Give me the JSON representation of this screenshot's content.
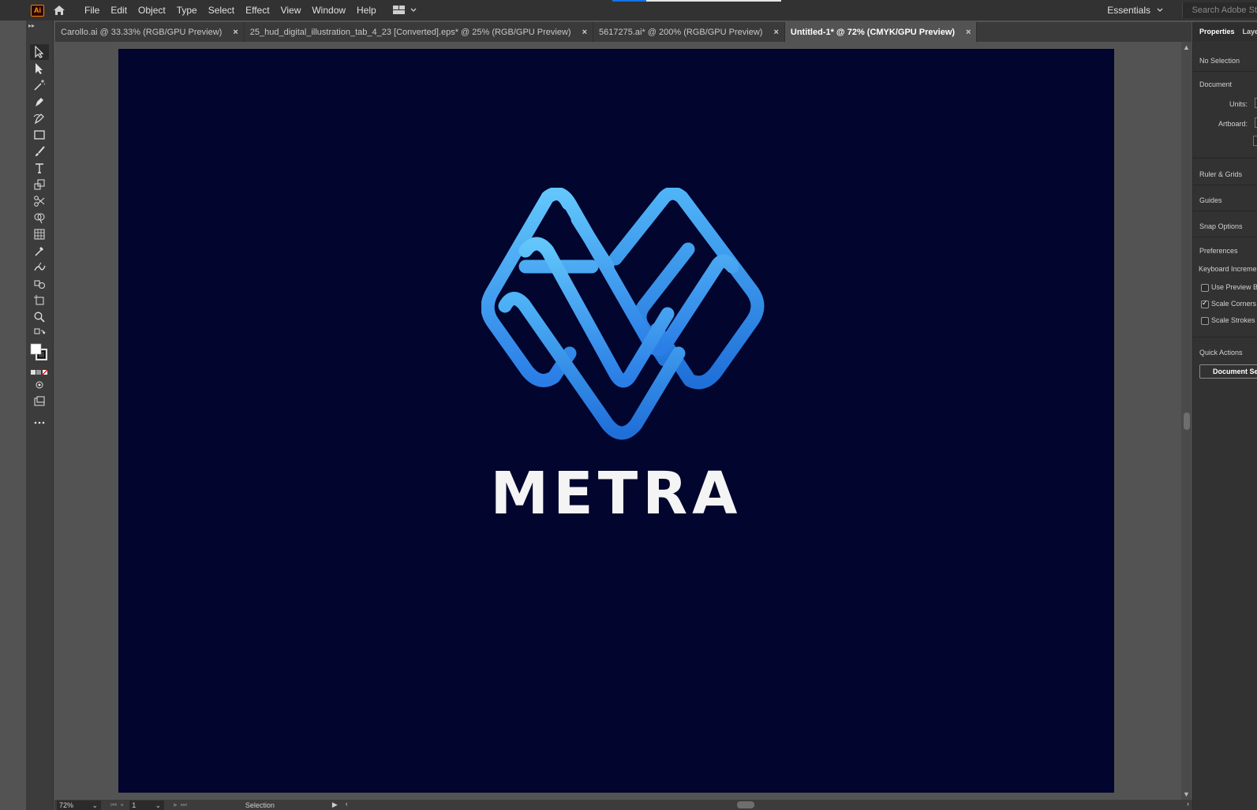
{
  "app": {
    "logo": "Ai"
  },
  "menu": [
    "File",
    "Edit",
    "Object",
    "Type",
    "Select",
    "Effect",
    "View",
    "Window",
    "Help"
  ],
  "workspace": {
    "label": "Essentials"
  },
  "search": {
    "placeholder": "Search Adobe St"
  },
  "tabs": [
    {
      "label": "Carollo.ai @ 33.33% (RGB/GPU Preview)",
      "close": "×",
      "active": false
    },
    {
      "label": "25_hud_digital_illustration_tab_4_23 [Converted].eps* @ 25% (RGB/GPU Preview)",
      "close": "×",
      "active": false
    },
    {
      "label": "5617275.ai* @ 200% (RGB/GPU Preview)",
      "close": "×",
      "active": false
    },
    {
      "label": "Untitled-1* @ 72% (CMYK/GPU Preview)",
      "close": "×",
      "active": true
    }
  ],
  "artwork": {
    "wordmark": "METRA",
    "background": "#02052e",
    "gradient_top": "#62c6fb",
    "gradient_bottom": "#2a7ee6"
  },
  "status": {
    "zoom": "72%",
    "page": "1",
    "mode": "Selection"
  },
  "panel": {
    "tabs": [
      "Properties",
      "Layers"
    ],
    "no_selection": "No Selection",
    "document": "Document",
    "units_label": "Units:",
    "artboard_label": "Artboard:",
    "ruler_grids": "Ruler & Grids",
    "guides": "Guides",
    "snap_options": "Snap Options",
    "preferences": "Preferences",
    "keyboard_increment": "Keyboard Increment",
    "use_preview_bounds": "Use Preview Bounds",
    "scale_corners": "Scale Corners",
    "scale_strokes": "Scale Strokes & Effects",
    "quick_actions": "Quick Actions",
    "document_setup_btn": "Document Setup"
  },
  "toolbar_icons": [
    "selection-tool-icon",
    "direct-selection-tool-icon",
    "magic-wand-tool-icon",
    "pen-tool-icon",
    "curvature-tool-icon",
    "rectangle-tool-icon",
    "paintbrush-tool-icon",
    "type-tool-icon",
    "scale-tool-icon",
    "scissors-tool-icon",
    "shape-builder-tool-icon",
    "perspective-grid-tool-icon",
    "eyedropper-tool-icon",
    "puppet-warp-tool-icon",
    "symbol-sprayer-tool-icon",
    "artboard-tool-icon",
    "zoom-tool-icon"
  ]
}
